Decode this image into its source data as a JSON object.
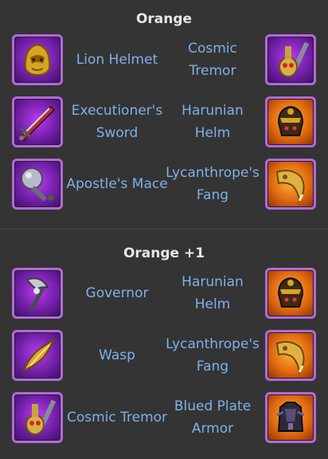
{
  "sections": [
    {
      "title": "Orange",
      "rows": [
        {
          "left": {
            "name": "Lion Helmet",
            "icon": "lion-helmet-icon"
          },
          "right": {
            "name": "Cosmic Tremor",
            "icon": "cosmic-tremor-icon"
          }
        },
        {
          "left": {
            "name": "Executioner's Sword",
            "icon": "executioners-sword-icon"
          },
          "right": {
            "name": "Harunian Helm",
            "icon": "harunian-helm-icon"
          }
        },
        {
          "left": {
            "name": "Apostle's Mace",
            "icon": "apostles-mace-icon"
          },
          "right": {
            "name": "Lycanthrope's Fang",
            "icon": "lycanthropes-fang-icon"
          }
        }
      ]
    },
    {
      "title": "Orange +1",
      "rows": [
        {
          "left": {
            "name": "Governor",
            "icon": "governor-axe-icon"
          },
          "right": {
            "name": "Harunian Helm",
            "icon": "harunian-helm-icon"
          }
        },
        {
          "left": {
            "name": "Wasp",
            "icon": "wasp-blade-icon"
          },
          "right": {
            "name": "Lycanthrope's Fang",
            "icon": "lycanthropes-fang-icon"
          }
        },
        {
          "left": {
            "name": "Cosmic Tremor",
            "icon": "cosmic-tremor-icon"
          },
          "right": {
            "name": "Blued Plate Armor",
            "icon": "blued-plate-armor-icon"
          }
        }
      ]
    }
  ],
  "colors": {
    "background": "#343434",
    "title": "#e6e6e6",
    "item_name": "#7fb1e8",
    "frame": "#b36ad8",
    "purple_bg": "#7220a8",
    "orange_bg": "#e06a10"
  }
}
